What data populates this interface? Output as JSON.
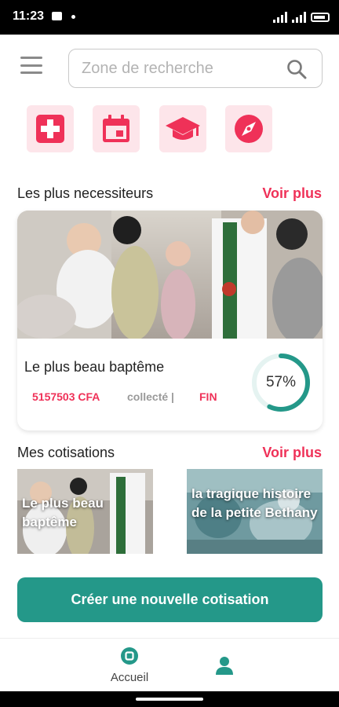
{
  "status_bar": {
    "time": "11:23",
    "battery_label": ""
  },
  "search": {
    "placeholder": "Zone de recherche"
  },
  "categories": [
    {
      "icon": "health-cross-icon"
    },
    {
      "icon": "calendar-icon"
    },
    {
      "icon": "graduation-cap-icon"
    },
    {
      "icon": "compass-icon"
    }
  ],
  "needy": {
    "title": "Les plus necessiteurs",
    "see_more": "Voir plus",
    "card": {
      "title": "Le plus beau baptême",
      "amount": "5157503 CFA",
      "collected": "collecté |",
      "status": "FIN",
      "progress": 57,
      "progress_label": "57%"
    }
  },
  "contributions": {
    "title": "Mes cotisations",
    "see_more": "Voir plus",
    "items": [
      {
        "label": "Le plus beau baptême"
      },
      {
        "label": "la tragique histoire de la petite Bethany"
      }
    ]
  },
  "create_button": "Créer une nouvelle cotisation",
  "bottom_nav": {
    "home_label": "Accueil"
  },
  "colors": {
    "accent": "#ef3158",
    "primary": "#249889",
    "category_bg": "#fde5ea"
  }
}
